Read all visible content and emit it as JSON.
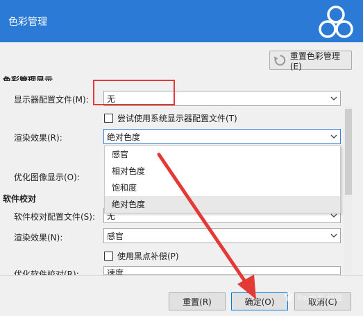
{
  "window": {
    "title": "色彩管理"
  },
  "toolbar": {
    "reset_color_management": "重置色彩管理(E)"
  },
  "sections": {
    "color_management_display": "色彩管理显示",
    "soft_proofing": "软件校对"
  },
  "fields": {
    "display_profile": {
      "label": "显示器配置文件(M):",
      "value": "无"
    },
    "try_system_profile": {
      "label": "尝试使用系统显示器配置文件(T)"
    },
    "rendering_intent": {
      "label": "渲染效果(R):",
      "value": "绝对色度"
    },
    "optimize_display": {
      "label": "优化图像显示(O):"
    },
    "proof_profile": {
      "label": "软件校对配置文件(S):",
      "value": "无"
    },
    "proof_rendering_intent": {
      "label": "渲染效果(N):",
      "value": "感官"
    },
    "black_point": {
      "label": "使用黑点补偿(P)"
    },
    "optimize_proof": {
      "label": "优化软件校对(R):",
      "value": "速度"
    }
  },
  "dropdown": {
    "options": [
      "感官",
      "相对色度",
      "饱和度",
      "绝对色度"
    ],
    "selected_index": 3
  },
  "buttons": {
    "reset": "重置(R)",
    "ok": "确定(O)",
    "cancel": "取消(C)"
  },
  "watermark": {
    "text": "Bai百度 经验"
  },
  "colors": {
    "titlebar": "#2b7bd6",
    "annotation": "#e53935",
    "focus": "#3c7fd6"
  }
}
